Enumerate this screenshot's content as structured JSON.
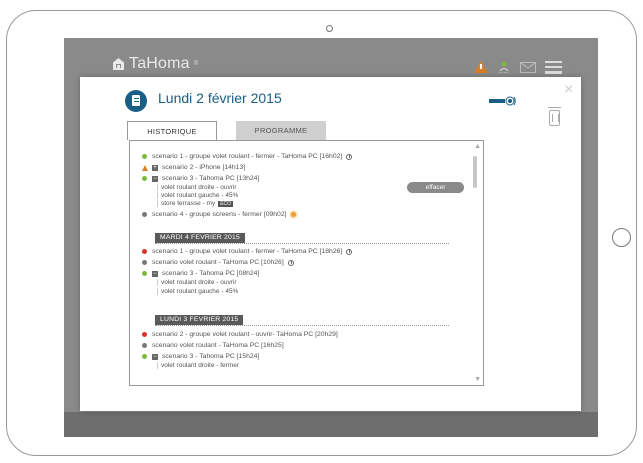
{
  "brand": {
    "logo_text": "TaHoma",
    "registered": "®"
  },
  "header": {
    "icons": [
      "warning-icon",
      "user-location-icon",
      "mail-icon",
      "menu-icon"
    ]
  },
  "modal": {
    "date_title": "Lundi 2 février 2015",
    "close_label": "×",
    "tabs": {
      "history": "HISTORIQUE",
      "program": "PROGRAMME"
    },
    "clear_button": "effacer"
  },
  "history": {
    "day1": {
      "entries": [
        {
          "text": "scenario 1 - groupe volet roulant - fermer - TaHoma PC [16h02]",
          "status": "success"
        },
        {
          "text": "scenario 2 - iPhone [14h13]",
          "status": "warning"
        },
        {
          "text": "scenario 3 - Tahoma PC [13h24]",
          "status": "success"
        },
        {
          "text": "volet roulant droite - ouvrir"
        },
        {
          "text": "volet roulant gauche - 45%"
        },
        {
          "text": "store terrasse - my",
          "tag": "ECO"
        },
        {
          "text": "scenario 4 - groupe screens - fermer [09h02]",
          "status": "neutral"
        }
      ]
    },
    "day2": {
      "label": "MARDI 4 FEVRIER 2015",
      "entries": [
        {
          "text": "scenario 1 - groupe volet roulant - fermer - TaHoma PC [18h26]",
          "status": "error"
        },
        {
          "text": "scenario volet roulant - TaHoma PC [10h26]",
          "status": "neutral"
        },
        {
          "text": "scenario 3 - Tahoma PC [08h24]",
          "status": "success"
        },
        {
          "text": "volet roulant droite - ouvrir"
        },
        {
          "text": "volet roulant gauche - 45%"
        }
      ]
    },
    "day3": {
      "label": "LUNDI 3 FEVRIER 2015",
      "entries": [
        {
          "text": "scenario 2 - groupe volet roulant - ouvrir- TaHoma PC [20h29]",
          "status": "error"
        },
        {
          "text": "scenario volet roulant - TaHoma PC [16h25]",
          "status": "neutral"
        },
        {
          "text": "scenario 3 - Tahoma PC [15h24]",
          "status": "success"
        },
        {
          "text": "volet roulant droite - fermer"
        }
      ]
    }
  },
  "colors": {
    "success": "#7cb93b",
    "warning": "#d4812a",
    "error": "#d9342b",
    "neutral": "#777777",
    "accent": "#1a5e86"
  }
}
